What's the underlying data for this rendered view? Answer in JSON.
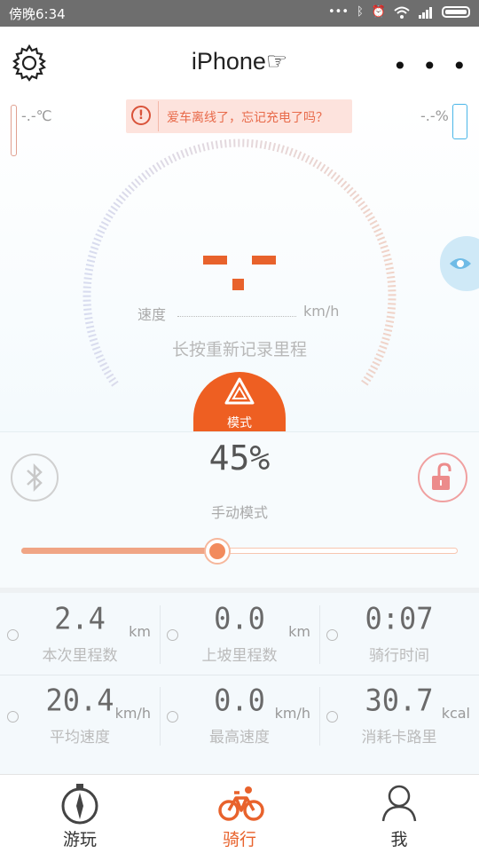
{
  "status_bar": {
    "time": "傍晚6:34",
    "icons": [
      "more-dots-icon",
      "bluetooth-icon",
      "alarm-icon",
      "wifi-icon",
      "signal-icon",
      "battery-icon"
    ]
  },
  "header": {
    "title": "iPhone☞",
    "menu_label": "• • •"
  },
  "top_info": {
    "temperature": "-.-℃",
    "alert": "爱车离线了，忘记充电了吗？",
    "battery_percent": "-.-%"
  },
  "speedometer": {
    "speed_label": "速度",
    "speed_unit": "km/h",
    "reset_hint": "长按重新记录里程",
    "speed_display": "- -"
  },
  "mode_button": {
    "label": "模式"
  },
  "assist": {
    "percent": "45%",
    "mode_label": "手动模式",
    "level": 0.45
  },
  "stats": [
    {
      "value": "2.4",
      "unit": "km",
      "label": "本次里程数",
      "icon": "distance-icon"
    },
    {
      "value": "0.0",
      "unit": "km",
      "label": "上坡里程数",
      "icon": "climb-icon"
    },
    {
      "value": "0:07",
      "unit": "",
      "label": "骑行时间",
      "icon": "clock-icon"
    },
    {
      "value": "20.4",
      "unit": "km/h",
      "label": "平均速度",
      "icon": "avg-speed-icon"
    },
    {
      "value": "0.0",
      "unit": "km/h",
      "label": "最高速度",
      "icon": "max-speed-icon"
    },
    {
      "value": "30.7",
      "unit": "kcal",
      "label": "消耗卡路里",
      "icon": "calorie-icon"
    }
  ],
  "tabs": [
    {
      "label": "游玩",
      "icon": "compass-icon",
      "active": false
    },
    {
      "label": "骑行",
      "icon": "bicycle-icon",
      "active": true
    },
    {
      "label": "我",
      "icon": "user-icon",
      "active": false
    }
  ],
  "colors": {
    "accent": "#ee5f22",
    "active_tab": "#e8622c",
    "alert_bg": "#fde3dd",
    "alert_text": "#e86a4a",
    "battery_outline": "#4ab6e8"
  }
}
